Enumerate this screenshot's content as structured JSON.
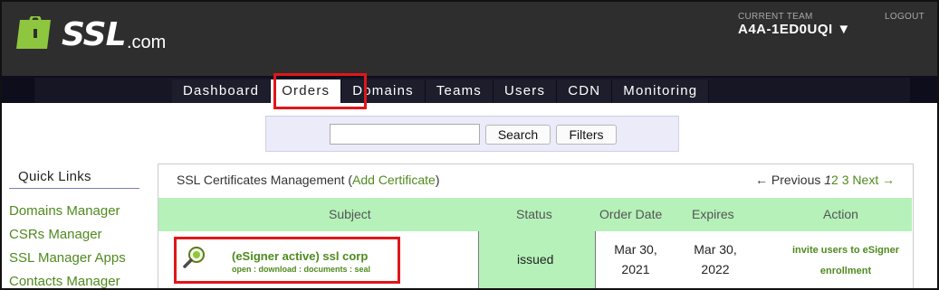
{
  "header": {
    "logo_ssl": "SSL",
    "logo_com": ".com",
    "team_label": "CURRENT TEAM",
    "team_value": "A4A-1ED0UQI ▼",
    "logout": "LOGOUT"
  },
  "nav": {
    "items": [
      "Dashboard",
      "Orders",
      "Domains",
      "Teams",
      "Users",
      "CDN",
      "Monitoring"
    ],
    "active": "Orders"
  },
  "search": {
    "value": "",
    "placeholder": "",
    "search_label": "Search",
    "filters_label": "Filters"
  },
  "quick_links": {
    "title": "Quick Links",
    "items": [
      "Domains Manager",
      "CSRs Manager",
      "SSL Manager Apps",
      "Contacts Manager"
    ]
  },
  "panel": {
    "title_prefix": "SSL Certificates Management (",
    "add_label": "Add Certificate",
    "title_suffix": ")",
    "pager_prev": "← Previous",
    "pager_current": "1",
    "pager_pages": [
      "2",
      "3"
    ],
    "pager_next": "Next →"
  },
  "table": {
    "headers": [
      "Subject",
      "Status",
      "Order Date",
      "Expires",
      "Action"
    ],
    "rows": [
      {
        "subject": "(eSigner active) ssl corp",
        "links": "open : download : documents : seal",
        "status": "issued",
        "order_date": [
          "Mar 30,",
          "2021"
        ],
        "expires": [
          "Mar 30,",
          "2022"
        ],
        "action": [
          "invite users to eSigner",
          "enrollment"
        ]
      }
    ]
  },
  "colors": {
    "accent_green": "#4f8a1e",
    "header_bg": "#2e2e2e",
    "table_header_bg": "#b5f1b9",
    "highlight_red": "#e0161a"
  },
  "icons": {
    "subject_icon": "magnifier-icon",
    "team_dropdown": "triangle-down-icon"
  }
}
